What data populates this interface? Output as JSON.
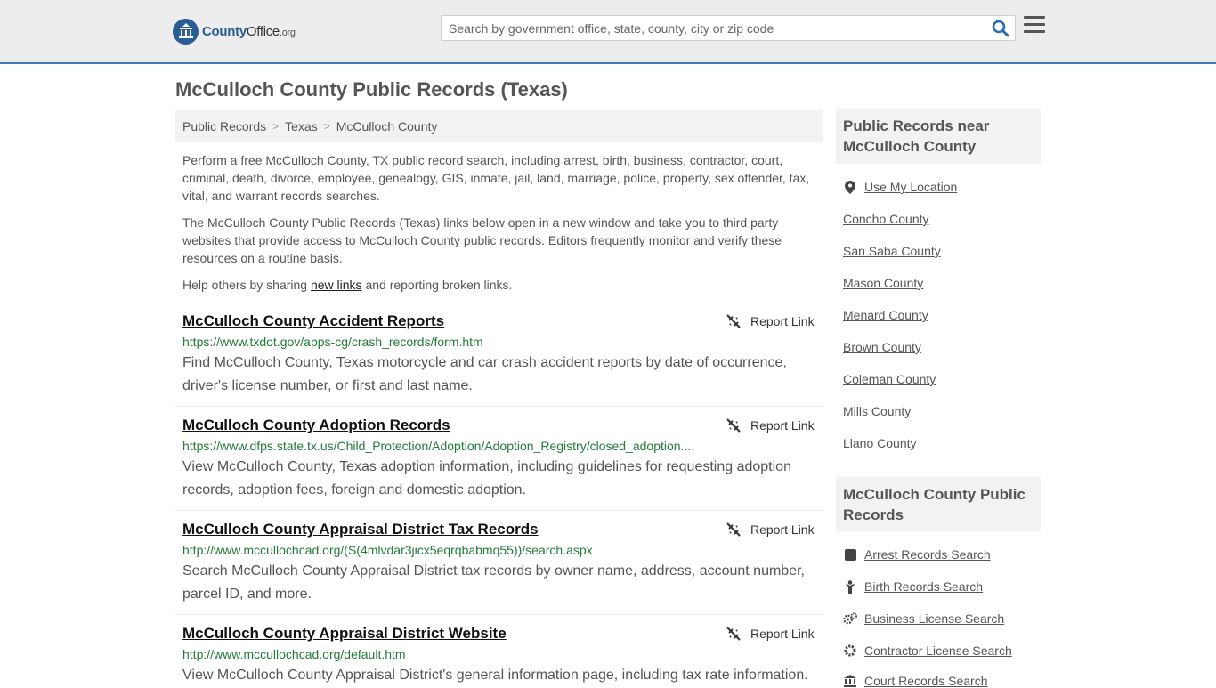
{
  "header": {
    "logo_brand": "County",
    "logo_rest": "Office",
    "logo_tld": ".org",
    "search_placeholder": "Search by government office, state, county, city or zip code"
  },
  "page_title": "McCulloch County Public Records (Texas)",
  "breadcrumb": [
    "Public Records",
    "Texas",
    "McCulloch County"
  ],
  "intro": {
    "p1": "Perform a free McCulloch County, TX public record search, including arrest, birth, business, contractor, court, criminal, death, divorce, employee, genealogy, GIS, inmate, jail, land, marriage, police, property, sex offender, tax, vital, and warrant records searches.",
    "p2": "The McCulloch County Public Records (Texas) links below open in a new window and take you to third party websites that provide access to McCulloch County public records. Editors frequently monitor and verify these resources on a routine basis.",
    "p3_before": "Help others by sharing ",
    "p3_link": "new links",
    "p3_after": " and reporting broken links."
  },
  "report_label": "Report Link",
  "records": [
    {
      "title": "McCulloch County Accident Reports",
      "url": "https://www.txdot.gov/apps-cg/crash_records/form.htm",
      "desc": "Find McCulloch County, Texas motorcycle and car crash accident reports by date of occurrence, driver's license number, or first and last name."
    },
    {
      "title": "McCulloch County Adoption Records",
      "url": "https://www.dfps.state.tx.us/Child_Protection/Adoption/Adoption_Registry/closed_adoption...",
      "desc": "View McCulloch County, Texas adoption information, including guidelines for requesting adoption records, adoption fees, foreign and domestic adoption."
    },
    {
      "title": "McCulloch County Appraisal District Tax Records",
      "url": "http://www.mccullochcad.org/(S(4mlvdar3jicx5eqrqbabmq55))/search.aspx",
      "desc": "Search McCulloch County Appraisal District tax records by owner name, address, account number, parcel ID, and more."
    },
    {
      "title": "McCulloch County Appraisal District Website",
      "url": "http://www.mccullochcad.org/default.htm",
      "desc": "View McCulloch County Appraisal District's general information page, including tax rate information."
    }
  ],
  "sidebar": {
    "nearby_heading": "Public Records near McCulloch County",
    "use_location": "Use My Location",
    "nearby": [
      "Concho County",
      "San Saba County",
      "Mason County",
      "Menard County",
      "Brown County",
      "Coleman County",
      "Mills County",
      "Llano County"
    ],
    "records_heading": "McCulloch County Public Records",
    "record_links": [
      {
        "label": "Arrest Records Search",
        "icon": "square-icon"
      },
      {
        "label": "Birth Records Search",
        "icon": "baby-icon"
      },
      {
        "label": "Business License Search",
        "icon": "gears-icon"
      },
      {
        "label": "Contractor License Search",
        "icon": "gear-icon"
      },
      {
        "label": "Court Records Search",
        "icon": "courthouse-icon"
      }
    ]
  }
}
